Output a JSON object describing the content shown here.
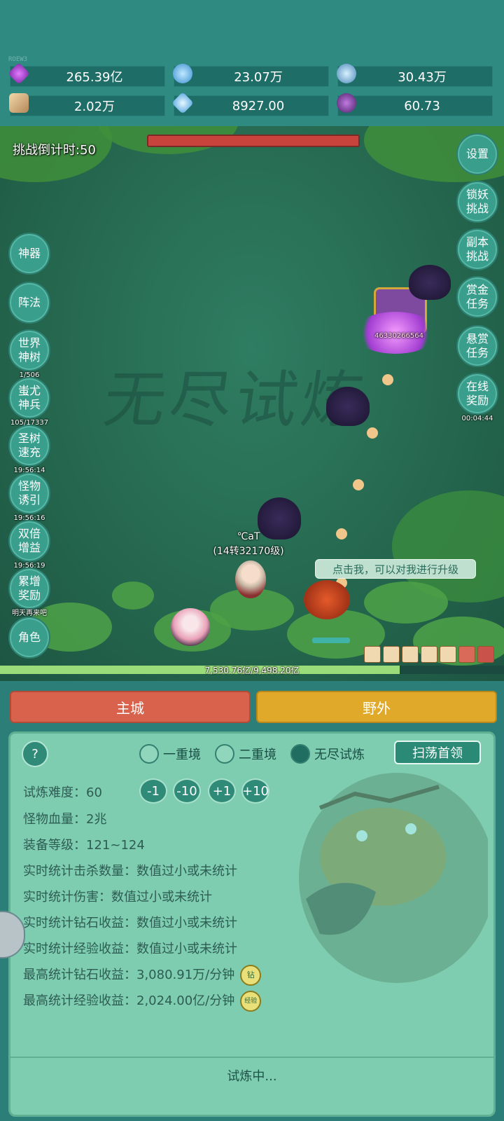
{
  "version": "ROEW3",
  "resources": [
    {
      "name": "diamond",
      "value": "265.39亿",
      "icon": "purple-gem-icon",
      "color": "#b347d9"
    },
    {
      "name": "blue-crystal",
      "value": "23.07万",
      "icon": "blue-crystal-icon",
      "color": "#5ab0e8"
    },
    {
      "name": "orb",
      "value": "30.43万",
      "icon": "blue-orb-icon",
      "color": "#6ab6d8"
    },
    {
      "name": "scroll",
      "value": "2.02万",
      "icon": "scroll-icon",
      "color": "#d8b27a"
    },
    {
      "name": "shard",
      "value": "8927.00",
      "icon": "ice-shard-icon",
      "color": "#7ec6f0"
    },
    {
      "name": "potion",
      "value": "60.73",
      "icon": "purple-pot-icon",
      "color": "#7a3fa0"
    }
  ],
  "battle": {
    "countdown": "挑战倒计时:50",
    "watermark": "无尽试炼",
    "boss_damage": "46330266564",
    "player_name": "℃aT",
    "player_level": "(14转32170级)",
    "tip": "点击我，可以对我进行升级",
    "hp_text": "7,530.76亿/9,498.20亿",
    "hp_fraction": 0.793
  },
  "left_buttons": [
    {
      "label": "神器",
      "sub": ""
    },
    {
      "label": "阵法",
      "sub": ""
    },
    {
      "label": "世界神树",
      "sub": "1/506"
    },
    {
      "label": "蚩尤神兵",
      "sub": "105/17337"
    },
    {
      "label": "圣树速充",
      "sub": "19:56:14"
    },
    {
      "label": "怪物诱引",
      "sub": "19:56:16"
    },
    {
      "label": "双倍增益",
      "sub": "19:56:19"
    },
    {
      "label": "累增奖励",
      "sub": "明天再来吧"
    },
    {
      "label": "角色",
      "sub": ""
    }
  ],
  "right_buttons": [
    {
      "label": "设置",
      "sub": ""
    },
    {
      "label": "锁妖挑战",
      "sub": ""
    },
    {
      "label": "副本挑战",
      "sub": ""
    },
    {
      "label": "赏金任务",
      "sub": ""
    },
    {
      "label": "悬赏任务",
      "sub": ""
    },
    {
      "label": "在线奖励",
      "sub": "00:04:44"
    }
  ],
  "tabs": {
    "main_city": "主城",
    "wild": "野外"
  },
  "panel": {
    "help": "?",
    "modes": [
      "一重境",
      "二重境",
      "无尽试炼"
    ],
    "selected_mode": "无尽试炼",
    "sweep": "扫荡首领",
    "difficulty_label": "试炼难度：",
    "difficulty_value": "60",
    "adjust": [
      "-1",
      "-10",
      "+1",
      "+10"
    ],
    "rows": [
      "怪物血量：2兆",
      "装备等级：121~124",
      "实时统计击杀数量：数值过小或未统计",
      "实时统计伤害：数值过小或未统计",
      "实时统计钻石收益：数值过小或未统计",
      "实时统计经验收益：数值过小或未统计",
      "最高统计钻石收益：3,080.91万/分钟",
      "最高统计经验收益：2,024.00亿/分钟"
    ],
    "badge_diamond": "钻",
    "badge_exp": "经验",
    "status": "试炼中..."
  }
}
